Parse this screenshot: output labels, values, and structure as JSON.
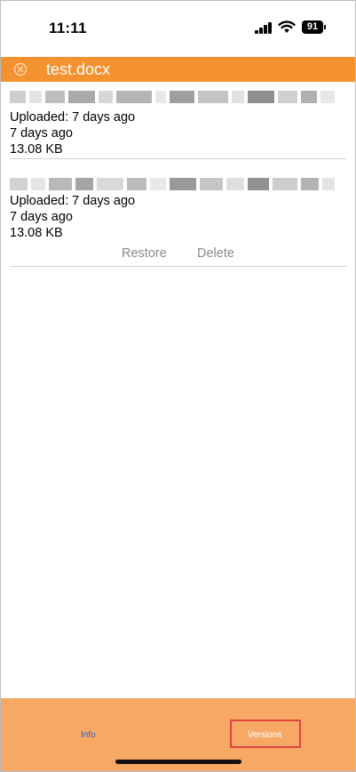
{
  "status_bar": {
    "time": "11:11",
    "battery": "91"
  },
  "header": {
    "title": "test.docx",
    "color": "#f59230"
  },
  "versions": [
    {
      "uploaded": "Uploaded: 7 days ago",
      "modified": "7 days ago",
      "size": "13.08 KB"
    },
    {
      "uploaded": "Uploaded: 7 days ago",
      "modified": "7 days ago",
      "size": "13.08 KB",
      "actions": {
        "restore": "Restore",
        "delete": "Delete"
      }
    }
  ],
  "tabs": {
    "info": "Info",
    "versions": "Versions"
  },
  "colors": {
    "accent": "#f59230",
    "tabbar": "#f7a865",
    "link": "#2f62c5",
    "highlight": "#e0423e"
  }
}
